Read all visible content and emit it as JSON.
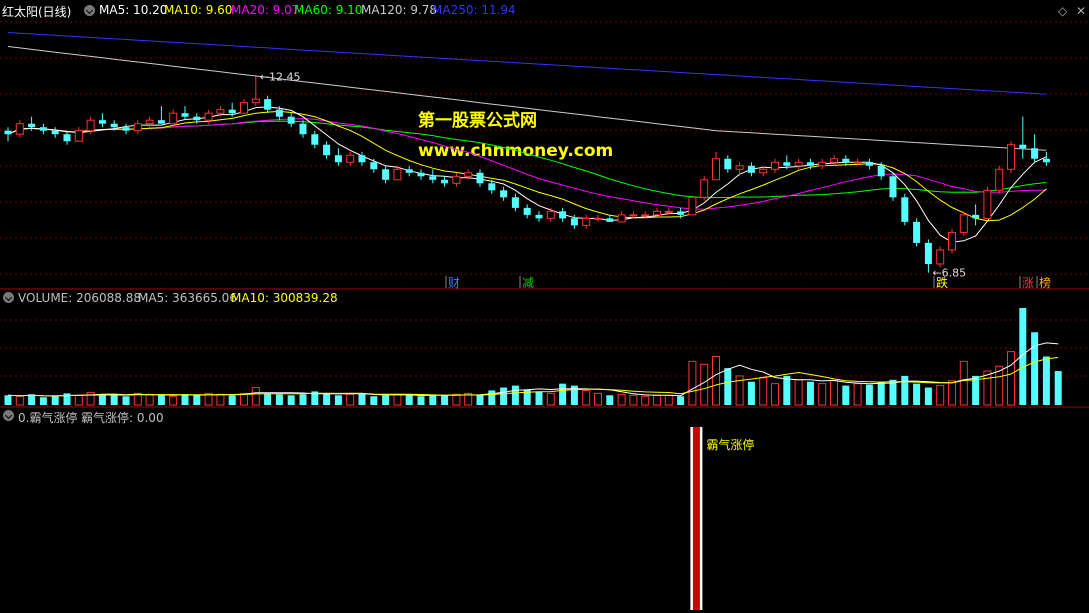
{
  "header": {
    "stock_name": "红太阳(日线)",
    "ma_items": [
      {
        "label": "MA5: 10.20",
        "color": "#ffffff"
      },
      {
        "label": "MA10: 9.60",
        "color": "#ffff00"
      },
      {
        "label": "MA20: 9.07",
        "color": "#ff00ff"
      },
      {
        "label": "MA60: 9.10",
        "color": "#00ff00"
      },
      {
        "label": "MA120: 9.78",
        "color": "#cccccc"
      },
      {
        "label": "MA250: 11.94",
        "color": "#3333ff"
      }
    ]
  },
  "watermark": {
    "line1": "第一股票公式网",
    "line2": "www.chnmoney.com"
  },
  "price_annotations": {
    "high": "12.45",
    "low": "6.85"
  },
  "event_markers": [
    {
      "text": "财",
      "color": "#3a7bff"
    },
    {
      "text": "减",
      "color": "#00cc00"
    },
    {
      "text": "跌",
      "color": "#ffff00"
    },
    {
      "text": "涨",
      "color": "#ff3030"
    },
    {
      "text": "榜",
      "color": "#ffaa00"
    }
  ],
  "volume_header": {
    "volume": "VOLUME: 206088.88",
    "ma5": "MA5: 363665.06",
    "ma10": "MA10: 300839.28"
  },
  "indicator_header": {
    "name": "0.霸气涨停",
    "value": "霸气涨停: 0.00",
    "signal_label": "霸气涨停"
  },
  "colors": {
    "up": "#ff3232",
    "down": "#54ffff",
    "ma5": "#ffffff",
    "ma10": "#ffff00",
    "ma20": "#ff00ff",
    "ma60": "#00ff00",
    "ma120": "#cccccc",
    "ma250": "#3333ff",
    "grid": "#7a0000"
  },
  "chart_data": [
    {
      "type": "candlestick",
      "title": "红太阳(日线)",
      "ylim": [
        6.5,
        14.0
      ],
      "series": [
        {
          "name": "MA5",
          "last": 10.2
        },
        {
          "name": "MA10",
          "last": 9.6
        },
        {
          "name": "MA20",
          "last": 9.07
        },
        {
          "name": "MA60",
          "last": 9.1
        },
        {
          "name": "MA120",
          "last": 9.78
        },
        {
          "name": "MA250",
          "last": 11.94
        }
      ],
      "candles": [
        [
          10.9,
          11.0,
          10.6,
          10.8
        ],
        [
          10.8,
          11.2,
          10.7,
          11.1
        ],
        [
          11.1,
          11.3,
          10.9,
          11.0
        ],
        [
          11.0,
          11.1,
          10.8,
          10.9
        ],
        [
          10.9,
          11.0,
          10.7,
          10.8
        ],
        [
          10.8,
          10.9,
          10.5,
          10.6
        ],
        [
          10.6,
          11.0,
          10.6,
          10.9
        ],
        [
          10.9,
          11.3,
          10.8,
          11.2
        ],
        [
          11.2,
          11.4,
          11.0,
          11.1
        ],
        [
          11.1,
          11.2,
          10.9,
          11.0
        ],
        [
          11.0,
          11.1,
          10.8,
          10.9
        ],
        [
          10.9,
          11.2,
          10.8,
          11.1
        ],
        [
          11.1,
          11.3,
          11.0,
          11.2
        ],
        [
          11.2,
          11.6,
          11.1,
          11.1
        ],
        [
          11.1,
          11.5,
          11.0,
          11.4
        ],
        [
          11.4,
          11.6,
          11.2,
          11.3
        ],
        [
          11.3,
          11.4,
          11.1,
          11.2
        ],
        [
          11.2,
          11.5,
          11.1,
          11.4
        ],
        [
          11.4,
          11.6,
          11.3,
          11.5
        ],
        [
          11.5,
          11.7,
          11.3,
          11.4
        ],
        [
          11.4,
          11.8,
          11.4,
          11.7
        ],
        [
          11.7,
          12.45,
          11.6,
          11.8
        ],
        [
          11.8,
          11.9,
          11.4,
          11.5
        ],
        [
          11.5,
          11.6,
          11.2,
          11.3
        ],
        [
          11.3,
          11.4,
          11.0,
          11.1
        ],
        [
          11.1,
          11.2,
          10.7,
          10.8
        ],
        [
          10.8,
          10.9,
          10.4,
          10.5
        ],
        [
          10.5,
          10.6,
          10.1,
          10.2
        ],
        [
          10.2,
          10.4,
          9.9,
          10.0
        ],
        [
          10.0,
          10.3,
          9.9,
          10.2
        ],
        [
          10.2,
          10.3,
          9.9,
          10.0
        ],
        [
          10.0,
          10.1,
          9.7,
          9.8
        ],
        [
          9.8,
          9.9,
          9.4,
          9.5
        ],
        [
          9.5,
          9.9,
          9.5,
          9.8
        ],
        [
          9.8,
          9.9,
          9.6,
          9.7
        ],
        [
          9.7,
          9.8,
          9.5,
          9.6
        ],
        [
          9.6,
          9.8,
          9.4,
          9.5
        ],
        [
          9.5,
          9.6,
          9.3,
          9.4
        ],
        [
          9.4,
          9.7,
          9.3,
          9.6
        ],
        [
          9.6,
          9.8,
          9.5,
          9.7
        ],
        [
          9.7,
          9.8,
          9.3,
          9.4
        ],
        [
          9.4,
          9.5,
          9.1,
          9.2
        ],
        [
          9.2,
          9.3,
          8.9,
          9.0
        ],
        [
          9.0,
          9.1,
          8.6,
          8.7
        ],
        [
          8.7,
          8.8,
          8.4,
          8.5
        ],
        [
          8.5,
          8.6,
          8.3,
          8.4
        ],
        [
          8.4,
          8.7,
          8.3,
          8.6
        ],
        [
          8.6,
          8.7,
          8.3,
          8.4
        ],
        [
          8.4,
          8.5,
          8.1,
          8.2
        ],
        [
          8.2,
          8.5,
          8.1,
          8.4
        ],
        [
          8.4,
          8.5,
          8.3,
          8.4
        ],
        [
          8.4,
          8.5,
          8.3,
          8.3
        ],
        [
          8.3,
          8.6,
          8.3,
          8.5
        ],
        [
          8.5,
          8.6,
          8.4,
          8.5
        ],
        [
          8.5,
          8.6,
          8.4,
          8.5
        ],
        [
          8.5,
          8.7,
          8.5,
          8.6
        ],
        [
          8.6,
          8.7,
          8.5,
          8.6
        ],
        [
          8.6,
          8.7,
          8.4,
          8.5
        ],
        [
          8.5,
          9.0,
          8.5,
          9.0
        ],
        [
          9.0,
          9.6,
          8.9,
          9.5
        ],
        [
          9.5,
          10.3,
          9.5,
          10.1
        ],
        [
          10.1,
          10.2,
          9.7,
          9.8
        ],
        [
          9.8,
          10.0,
          9.6,
          9.9
        ],
        [
          9.9,
          10.0,
          9.6,
          9.7
        ],
        [
          9.7,
          9.9,
          9.6,
          9.8
        ],
        [
          9.8,
          10.1,
          9.7,
          10.0
        ],
        [
          10.0,
          10.2,
          9.8,
          9.9
        ],
        [
          9.9,
          10.1,
          9.8,
          10.0
        ],
        [
          10.0,
          10.1,
          9.8,
          9.9
        ],
        [
          9.9,
          10.1,
          9.8,
          10.0
        ],
        [
          10.0,
          10.2,
          9.9,
          10.1
        ],
        [
          10.1,
          10.2,
          9.9,
          10.0
        ],
        [
          10.0,
          10.1,
          9.9,
          10.0
        ],
        [
          10.0,
          10.1,
          9.8,
          9.9
        ],
        [
          9.9,
          10.0,
          9.5,
          9.6
        ],
        [
          9.6,
          9.7,
          8.9,
          9.0
        ],
        [
          9.0,
          9.1,
          8.2,
          8.3
        ],
        [
          8.3,
          8.4,
          7.6,
          7.7
        ],
        [
          7.7,
          7.8,
          6.85,
          7.1
        ],
        [
          7.1,
          7.6,
          7.0,
          7.5
        ],
        [
          7.5,
          8.1,
          7.4,
          8.0
        ],
        [
          8.0,
          8.6,
          7.9,
          8.5
        ],
        [
          8.5,
          8.8,
          8.2,
          8.4
        ],
        [
          8.4,
          9.3,
          8.4,
          9.2
        ],
        [
          9.2,
          9.9,
          9.1,
          9.8
        ],
        [
          9.8,
          10.6,
          9.7,
          10.5
        ],
        [
          10.5,
          11.3,
          10.1,
          10.4
        ],
        [
          10.4,
          10.8,
          10.0,
          10.1
        ],
        [
          10.1,
          10.3,
          9.9,
          10.0
        ]
      ]
    },
    {
      "type": "bar",
      "title": "VOLUME",
      "series": [
        {
          "name": "VOLUME",
          "last": 206088.88
        },
        {
          "name": "MA5",
          "last": 363665.06
        },
        {
          "name": "MA10",
          "last": 300839.28
        }
      ],
      "values": [
        0.1,
        0.09,
        0.11,
        0.08,
        0.09,
        0.12,
        0.1,
        0.13,
        0.11,
        0.1,
        0.09,
        0.12,
        0.11,
        0.1,
        0.09,
        0.11,
        0.1,
        0.12,
        0.11,
        0.1,
        0.12,
        0.18,
        0.12,
        0.11,
        0.1,
        0.11,
        0.14,
        0.12,
        0.1,
        0.11,
        0.12,
        0.09,
        0.1,
        0.11,
        0.1,
        0.09,
        0.1,
        0.1,
        0.11,
        0.12,
        0.1,
        0.15,
        0.18,
        0.2,
        0.16,
        0.14,
        0.12,
        0.22,
        0.2,
        0.15,
        0.12,
        0.1,
        0.11,
        0.1,
        0.09,
        0.1,
        0.1,
        0.09,
        0.45,
        0.42,
        0.5,
        0.38,
        0.3,
        0.24,
        0.28,
        0.22,
        0.3,
        0.26,
        0.24,
        0.22,
        0.25,
        0.2,
        0.22,
        0.21,
        0.24,
        0.26,
        0.3,
        0.22,
        0.18,
        0.2,
        0.25,
        0.45,
        0.3,
        0.35,
        0.4,
        0.55,
        1.0,
        0.75,
        0.5,
        0.35
      ]
    },
    {
      "type": "bar",
      "title": "0.霸气涨停",
      "series": [
        {
          "name": "霸气涨停",
          "last": 0.0
        }
      ],
      "signal_bar_index": 58
    }
  ]
}
